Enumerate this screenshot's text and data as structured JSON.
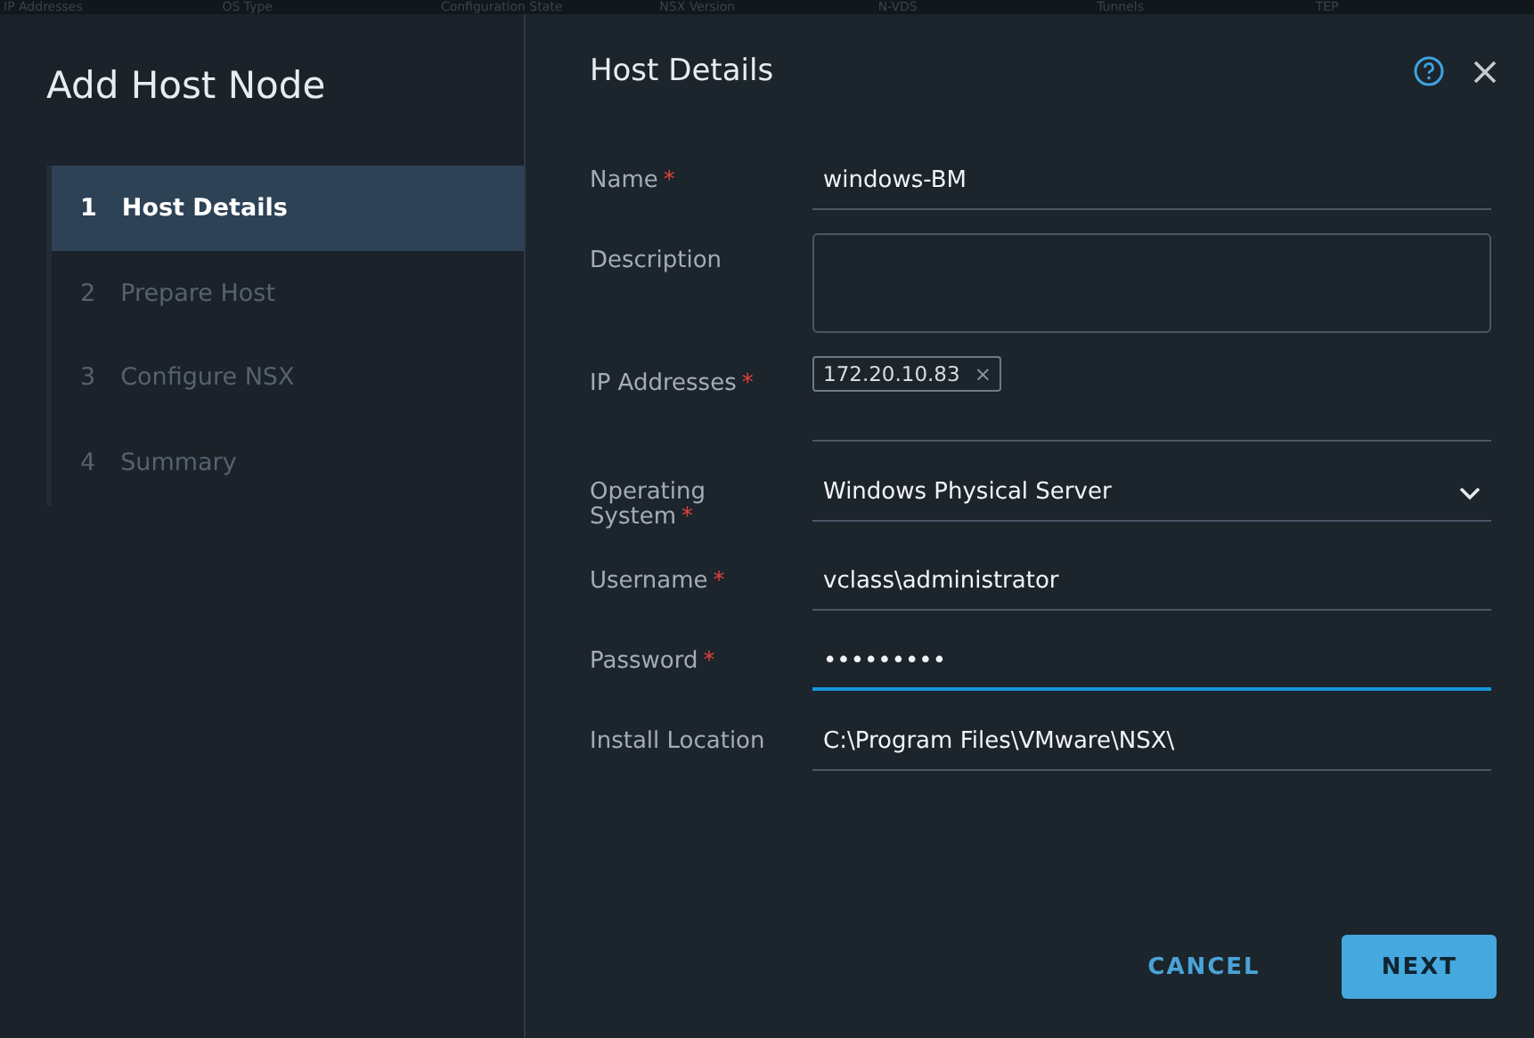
{
  "background_columns": [
    "IP Addresses",
    "OS Type",
    "Configuration State",
    "NSX Version",
    "N-VDS",
    "Tunnels",
    "TEP"
  ],
  "dialog": {
    "title": "Add Host Node",
    "section_title": "Host Details"
  },
  "steps": [
    {
      "number": "1",
      "label": "Host Details",
      "selected": true
    },
    {
      "number": "2",
      "label": "Prepare Host",
      "selected": false
    },
    {
      "number": "3",
      "label": "Configure NSX",
      "selected": false
    },
    {
      "number": "4",
      "label": "Summary",
      "selected": false
    }
  ],
  "fields": [
    {
      "kind": "text",
      "label": "Name",
      "required_mark": "*",
      "value": "windows-BM",
      "focused": false
    },
    {
      "kind": "textarea",
      "label": "Description"
    },
    {
      "kind": "tags",
      "label": "IP Addresses",
      "required_mark": "*",
      "tags": [
        "172.20.10.83"
      ],
      "tag_remove": "×"
    },
    {
      "kind": "select",
      "label": "Operating System",
      "required_mark": "*",
      "value": "Windows Physical Server",
      "focused": false
    },
    {
      "kind": "text",
      "label": "Username",
      "required_mark": "*",
      "value": "vclass\\administrator",
      "focused": false
    },
    {
      "kind": "text",
      "label": "Password",
      "required_mark": "*",
      "value": "•••••••••",
      "focused": true
    },
    {
      "kind": "text",
      "label": "Install Location",
      "value": "C:\\Program Files\\VMware\\NSX\\",
      "focused": false
    }
  ],
  "buttons": [
    {
      "kind": "flat",
      "label": "CANCEL"
    },
    {
      "kind": "primary",
      "label": "NEXT"
    }
  ]
}
